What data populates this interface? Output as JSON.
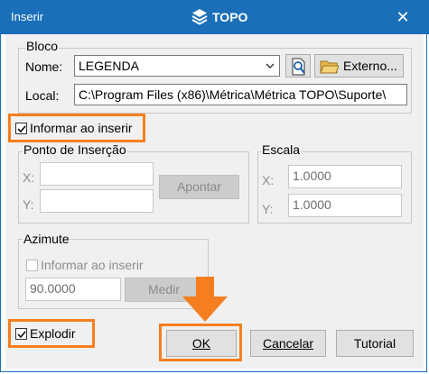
{
  "window": {
    "title": "Inserir",
    "brand": "TOPO",
    "close": "✕"
  },
  "bloco": {
    "legend": "Bloco",
    "nome_label": "Nome:",
    "nome_value": "LEGENDA",
    "externo_label": "Externo...",
    "local_label": "Local:",
    "local_value": "C:\\Program Files (x86)\\Métrica\\Métrica TOPO\\Suporte\\"
  },
  "informar_ao_inserir": {
    "label": "Informar ao inserir",
    "checked": true
  },
  "ponto": {
    "legend": "Ponto de Inserção",
    "x_label": "X:",
    "x_value": "",
    "y_label": "Y:",
    "y_value": "",
    "apontar_label": "Apontar"
  },
  "escala": {
    "legend": "Escala",
    "x_label": "X:",
    "x_value": "1.0000",
    "y_label": "Y:",
    "y_value": "1.0000"
  },
  "azimute": {
    "legend": "Azimute",
    "informar_label": "Informar ao inserir",
    "value": "90.0000",
    "medir_label": "Medir"
  },
  "explodir": {
    "label": "Explodir",
    "checked": true
  },
  "buttons": {
    "ok": "OK",
    "cancelar": "Cancelar",
    "tutorial": "Tutorial"
  },
  "colors": {
    "titlebar": "#1a6fb8",
    "highlight": "#f57f20",
    "dialog": "#f0f0f0"
  }
}
